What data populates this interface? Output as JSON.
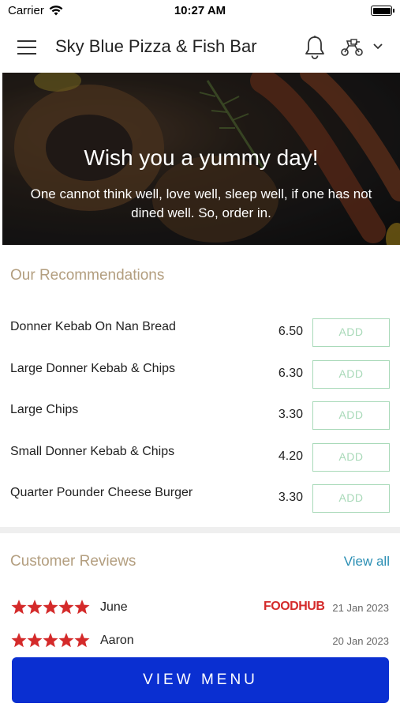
{
  "status_bar": {
    "carrier": "Carrier",
    "time": "10:27 AM",
    "wifi_icon": "wifi-icon",
    "battery_icon": "battery-icon"
  },
  "header": {
    "title": "Sky Blue Pizza & Fish Bar",
    "menu_icon": "hamburger-menu-icon",
    "notification_icon": "bell-icon",
    "delivery_icon": "scooter-icon",
    "dropdown_icon": "chevron-down-icon"
  },
  "hero": {
    "headline": "Wish you a yummy day!",
    "tagline": "One cannot think well, love well, sleep well, if one has not dined well. So, order in."
  },
  "recommendations": {
    "title": "Our Recommendations",
    "items": [
      {
        "name": "Donner Kebab On Nan Bread",
        "price": "6.50",
        "button": "ADD"
      },
      {
        "name": "Large Donner Kebab & Chips",
        "price": "6.30",
        "button": "ADD"
      },
      {
        "name": "Large Chips",
        "price": "3.30",
        "button": "ADD"
      },
      {
        "name": "Small Donner Kebab & Chips",
        "price": "4.20",
        "button": "ADD"
      },
      {
        "name": "Quarter Pounder Cheese Burger",
        "price": "3.30",
        "button": "ADD"
      }
    ]
  },
  "reviews": {
    "title": "Customer Reviews",
    "view_all": "View all",
    "items": [
      {
        "rating": 5,
        "name": "June",
        "source": "FOODHUB",
        "date": "21 Jan 2023"
      },
      {
        "rating": 5,
        "name": "Aaron",
        "source": "",
        "date": "20 Jan 2023"
      }
    ]
  },
  "footer": {
    "view_menu": "VIEW MENU"
  },
  "colors": {
    "accent_blue": "#0a2fd1",
    "section_title": "#b39e7f",
    "add_button": "#a8d9b8",
    "link": "#2b8fb4",
    "star": "#d42a2a"
  }
}
